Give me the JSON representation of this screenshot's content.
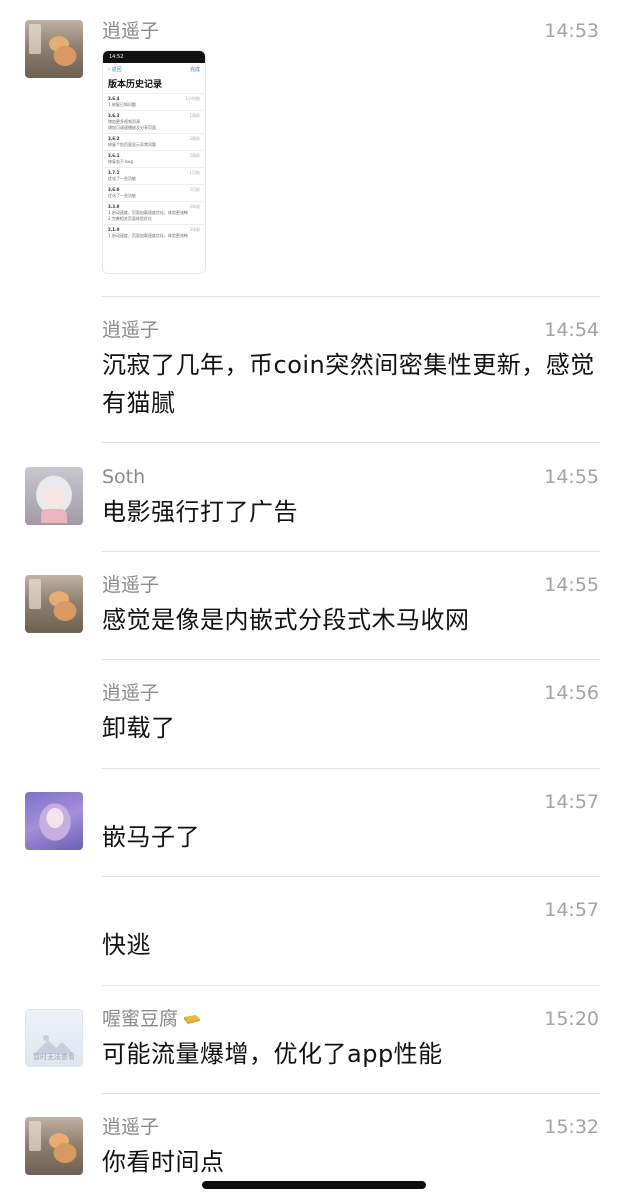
{
  "messages": [
    {
      "sender": "逍遥子",
      "time": "14:53",
      "text": "",
      "avatar": "cat-avatar"
    },
    {
      "sender": "逍遥子",
      "time": "14:54",
      "text": "沉寂了几年，币coin突然间密集性更新，感觉有猫腻",
      "avatar": ""
    },
    {
      "sender": "Soth",
      "time": "14:55",
      "text": "电影强行打了广告",
      "avatar": "anime-girl-avatar"
    },
    {
      "sender": "逍遥子",
      "time": "14:55",
      "text": "感觉是像是内嵌式分段式木马收网",
      "avatar": "cat-avatar"
    },
    {
      "sender": "逍遥子",
      "time": "14:56",
      "text": "卸载了",
      "avatar": ""
    },
    {
      "sender": "",
      "time": "14:57",
      "text": "嵌马子了",
      "avatar": "purple-avatar"
    },
    {
      "sender": "",
      "time": "14:57",
      "text": "快逃",
      "avatar": ""
    },
    {
      "sender": "喔蜜豆腐",
      "time": "15:20",
      "text": "可能流量爆增，优化了app性能",
      "avatar": "placeholder-avatar"
    },
    {
      "sender": "逍遥子",
      "time": "15:32",
      "text": "你看时间点",
      "avatar": "cat-avatar"
    }
  ],
  "placeholder_avatar_caption": "暂时无法查看",
  "sender_badge_icon": "gold-bar-icon",
  "thumbnail": {
    "status_time": "14:52",
    "nav_back": "返回",
    "nav_done": "完成",
    "title": "版本历史记录",
    "versions": [
      {
        "version": "3.6.4",
        "age": "1小时前",
        "notes": [
          "1 修复已知问题"
        ]
      },
      {
        "version": "3.6.3",
        "age": "1周前",
        "notes": [
          "增加更多视频资源",
          "增加可调速播放及分享页面"
        ]
      },
      {
        "version": "3.6.2",
        "age": "2周前",
        "notes": [
          "修复个别页面显示异常问题"
        ]
      },
      {
        "version": "3.6.1",
        "age": "2周前",
        "notes": [
          "修复若干 bug"
        ]
      },
      {
        "version": "3.7.1",
        "age": "1月前",
        "notes": [
          "优化了一些功能"
        ]
      },
      {
        "version": "3.6.0",
        "age": "2月前",
        "notes": [
          "优化了一些功能"
        ]
      },
      {
        "version": "3.3.0",
        "age": "2年前",
        "notes": [
          "1 启动速度、页面加载速度优化，体验更流畅",
          "2 完善相关页面体验优化"
        ]
      },
      {
        "version": "2.1.0",
        "age": "3年前",
        "notes": [
          "1 启动速度、页面加载速度优化，体验更流畅"
        ]
      }
    ]
  },
  "colors": {
    "background": "#ffffff",
    "sender_text": "#8a8a8a",
    "time_text": "#a3a3a3",
    "message_text": "#111111",
    "divider": "#e3e3e3",
    "link_blue": "#2f7cf6"
  }
}
